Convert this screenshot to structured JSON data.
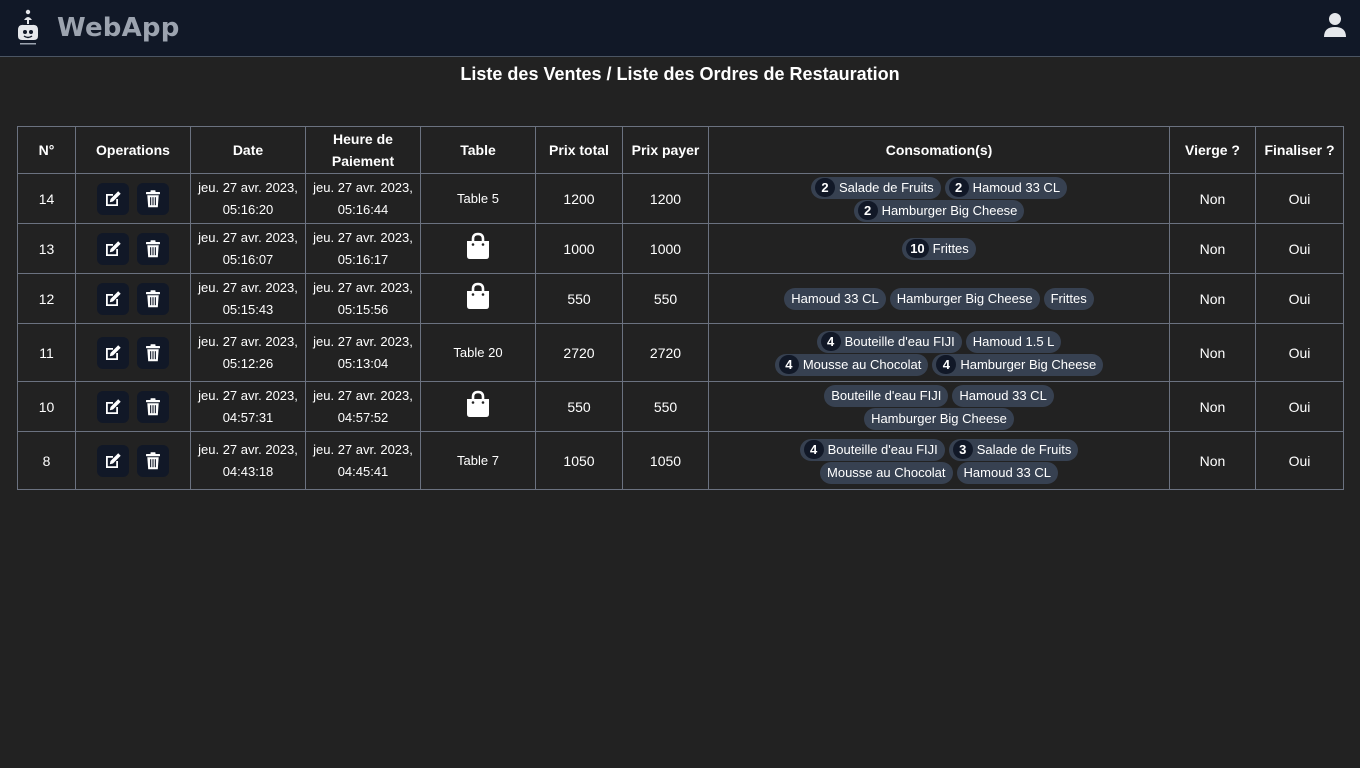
{
  "app": {
    "name": "WebApp",
    "icons": {
      "logo": "chef-logo-icon",
      "user": "user-icon"
    }
  },
  "page": {
    "title": "Liste des Ventes / Liste des Ordres de Restauration"
  },
  "table": {
    "headers": {
      "num": "N°",
      "operations": "Operations",
      "date": "Date",
      "heure": "Heure de Paiement",
      "table": "Table",
      "prix_total": "Prix total",
      "prix_payer": "Prix payer",
      "consommations": "Consomation(s)",
      "vierge": "Vierge ?",
      "finaliser": "Finaliser ?"
    },
    "row_icons": {
      "edit": "edit-icon",
      "delete": "trash-icon",
      "takeaway": "shopping-bag-icon"
    },
    "rows": [
      {
        "num": "14",
        "date": "jeu. 27 avr. 2023, 05:16:20",
        "heure": "jeu. 27 avr. 2023, 05:16:44",
        "table": "Table 5",
        "prix_total": "1200",
        "prix_payer": "1200",
        "items": [
          {
            "qty": "2",
            "name": "Salade de Fruits"
          },
          {
            "qty": "2",
            "name": "Hamoud 33 CL"
          },
          {
            "qty": "2",
            "name": "Hamburger Big Cheese"
          }
        ],
        "vierge": "Non",
        "finaliser": "Oui"
      },
      {
        "num": "13",
        "date": "jeu. 27 avr. 2023, 05:16:07",
        "heure": "jeu. 27 avr. 2023, 05:16:17",
        "table": "",
        "prix_total": "1000",
        "prix_payer": "1000",
        "items": [
          {
            "qty": "10",
            "name": "Frittes"
          }
        ],
        "vierge": "Non",
        "finaliser": "Oui"
      },
      {
        "num": "12",
        "date": "jeu. 27 avr. 2023, 05:15:43",
        "heure": "jeu. 27 avr. 2023, 05:15:56",
        "table": "",
        "prix_total": "550",
        "prix_payer": "550",
        "items": [
          {
            "qty": "",
            "name": "Hamoud 33 CL"
          },
          {
            "qty": "",
            "name": "Hamburger Big Cheese"
          },
          {
            "qty": "",
            "name": "Frittes"
          }
        ],
        "vierge": "Non",
        "finaliser": "Oui"
      },
      {
        "num": "11",
        "date": "jeu. 27 avr. 2023, 05:12:26",
        "heure": "jeu. 27 avr. 2023, 05:13:04",
        "table": "Table 20",
        "prix_total": "2720",
        "prix_payer": "2720",
        "items": [
          {
            "qty": "4",
            "name": "Bouteille d'eau FIJI"
          },
          {
            "qty": "",
            "name": "Hamoud 1.5 L"
          },
          {
            "qty": "4",
            "name": "Mousse au Chocolat"
          },
          {
            "qty": "4",
            "name": "Hamburger Big Cheese"
          }
        ],
        "vierge": "Non",
        "finaliser": "Oui"
      },
      {
        "num": "10",
        "date": "jeu. 27 avr. 2023, 04:57:31",
        "heure": "jeu. 27 avr. 2023, 04:57:52",
        "table": "",
        "prix_total": "550",
        "prix_payer": "550",
        "items": [
          {
            "qty": "",
            "name": "Bouteille d'eau FIJI"
          },
          {
            "qty": "",
            "name": "Hamoud 33 CL"
          },
          {
            "qty": "",
            "name": "Hamburger Big Cheese"
          }
        ],
        "vierge": "Non",
        "finaliser": "Oui"
      },
      {
        "num": "8",
        "date": "jeu. 27 avr. 2023, 04:43:18",
        "heure": "jeu. 27 avr. 2023, 04:45:41",
        "table": "Table 7",
        "prix_total": "1050",
        "prix_payer": "1050",
        "items": [
          {
            "qty": "4",
            "name": "Bouteille d'eau FIJI"
          },
          {
            "qty": "3",
            "name": "Salade de Fruits"
          },
          {
            "qty": "",
            "name": "Mousse au Chocolat"
          },
          {
            "qty": "",
            "name": "Hamoud 33 CL"
          }
        ],
        "vierge": "Non",
        "finaliser": "Oui"
      }
    ]
  }
}
